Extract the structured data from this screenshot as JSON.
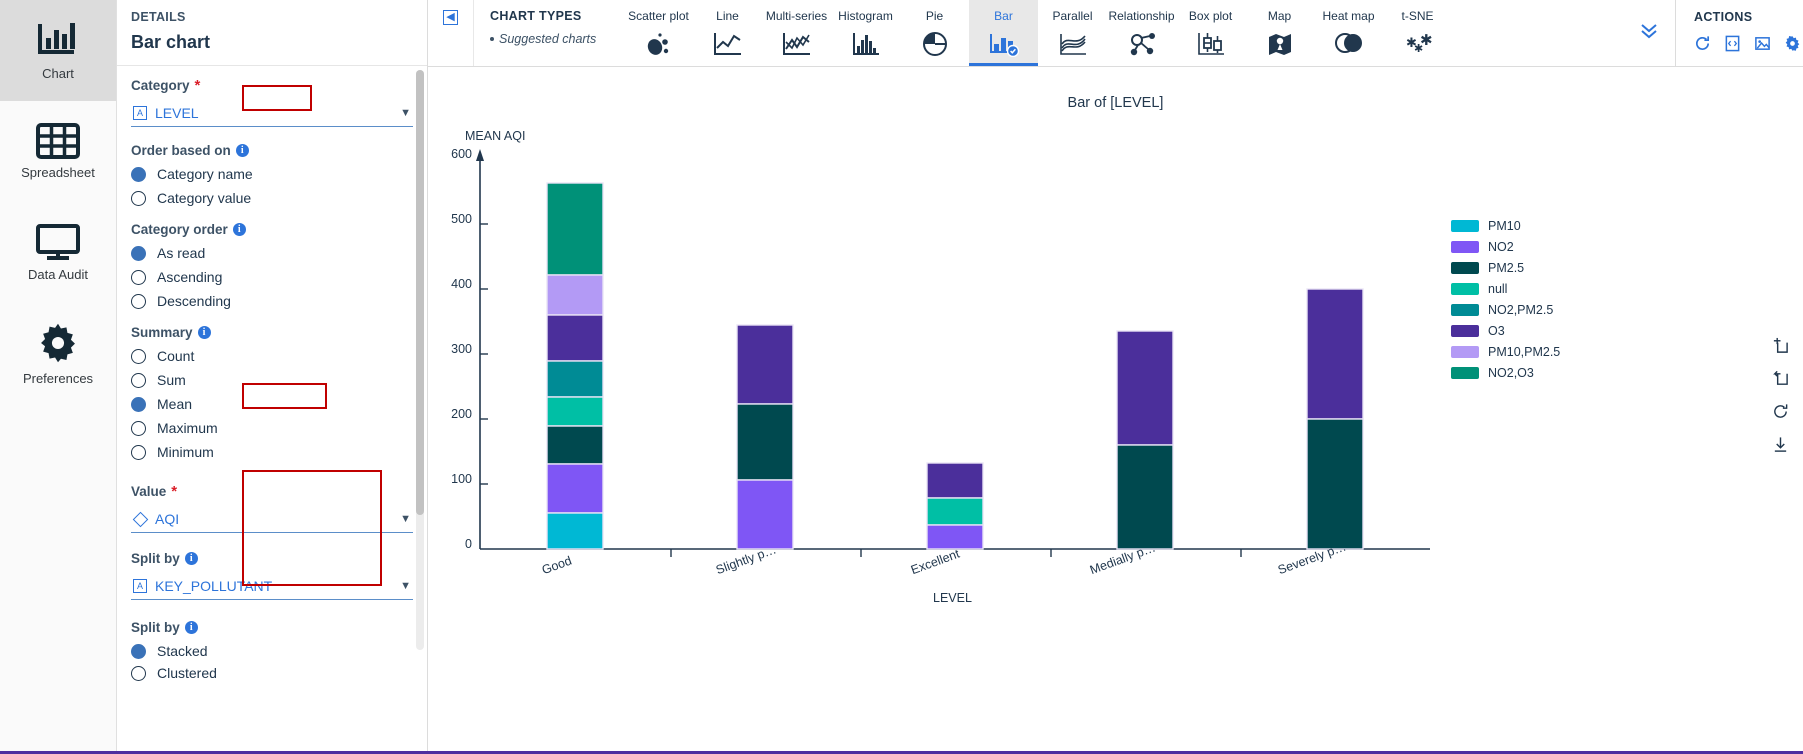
{
  "rail": {
    "items": [
      {
        "label": "Chart",
        "icon": "bar-chart-icon",
        "active": true
      },
      {
        "label": "Spreadsheet",
        "icon": "table-grid-icon",
        "active": false
      },
      {
        "label": "Data Audit",
        "icon": "monitor-icon",
        "active": false
      },
      {
        "label": "Preferences",
        "icon": "gear-icon",
        "active": false
      }
    ]
  },
  "details": {
    "kicker": "DETAILS",
    "title": "Bar chart",
    "category": {
      "label": "Category",
      "required": "*",
      "value": "LEVEL",
      "type_badge": "A"
    },
    "order_based_on": {
      "label": "Order based on",
      "options": [
        "Category name",
        "Category value"
      ],
      "selected": "Category name"
    },
    "category_order": {
      "label": "Category order",
      "options": [
        "As read",
        "Ascending",
        "Descending"
      ],
      "selected": "As read"
    },
    "summary": {
      "label": "Summary",
      "options": [
        "Count",
        "Sum",
        "Mean",
        "Maximum",
        "Minimum"
      ],
      "selected": "Mean"
    },
    "value": {
      "label": "Value",
      "required": "*",
      "value": "AQI",
      "type_badge": "diamond"
    },
    "split_by_field": {
      "label": "Split by",
      "value": "KEY_POLLUTANT",
      "type_badge": "A"
    },
    "split_by_mode": {
      "label": "Split by",
      "options": [
        "Stacked",
        "Clustered"
      ],
      "selected": "Stacked"
    }
  },
  "toolbar": {
    "collapse_icon": "collapse-panel-icon",
    "chart_types_title": "CHART TYPES",
    "suggested_label": "Suggested charts",
    "types": [
      {
        "label": "Scatter plot",
        "icon": "scatter-plot-icon",
        "selected": false
      },
      {
        "label": "Line",
        "icon": "line-chart-icon",
        "selected": false
      },
      {
        "label": "Multi-series",
        "icon": "multi-series-icon",
        "selected": false
      },
      {
        "label": "Histogram",
        "icon": "histogram-icon",
        "selected": false
      },
      {
        "label": "Pie",
        "icon": "pie-chart-icon",
        "selected": false
      },
      {
        "label": "Bar",
        "icon": "bar-chart-icon",
        "selected": true
      },
      {
        "label": "Parallel",
        "icon": "parallel-coords-icon",
        "selected": false
      },
      {
        "label": "Relationship",
        "icon": "relationship-graph-icon",
        "selected": false
      },
      {
        "label": "Box plot",
        "icon": "box-plot-icon",
        "selected": false
      },
      {
        "label": "Map",
        "icon": "map-icon",
        "selected": false
      },
      {
        "label": "Heat map",
        "icon": "heat-map-icon",
        "selected": false
      },
      {
        "label": "t-SNE",
        "icon": "tsne-icon",
        "selected": false
      }
    ],
    "more_icon": "chevron-double-down-icon"
  },
  "actions": {
    "title": "ACTIONS",
    "icons": [
      "refresh-icon",
      "export-code-icon",
      "export-image-icon",
      "gear-icon"
    ]
  },
  "side_tools": [
    "add-frame-icon",
    "undo-frame-icon",
    "reset-icon",
    "download-icon"
  ],
  "chart_data": {
    "type": "bar",
    "title": "Bar of [LEVEL]",
    "xlabel": "LEVEL",
    "ylabel": "MEAN AQI",
    "ylim": [
      0,
      600
    ],
    "yticks": [
      0,
      100,
      200,
      300,
      400,
      500,
      600
    ],
    "grid": false,
    "legend_position": "right",
    "stacked": true,
    "categories": [
      "Good",
      "Slightly p…",
      "Excellent",
      "Medially p…",
      "Severely p…"
    ],
    "series": [
      {
        "name": "PM10",
        "color": "#00b8d4",
        "values": [
          58,
          0,
          0,
          0,
          0
        ]
      },
      {
        "name": "NO2",
        "color": "#7f56f5",
        "values": [
          76,
          106,
          37,
          0,
          0
        ]
      },
      {
        "name": "PM2.5",
        "color": "#00494f",
        "values": [
          58,
          117,
          0,
          160,
          204
        ]
      },
      {
        "name": "null",
        "color": "#00bfa5",
        "values": [
          44,
          0,
          41,
          0,
          0
        ]
      },
      {
        "name": "NO2,PM2.5",
        "color": "#008b95",
        "values": [
          55,
          0,
          0,
          0,
          0
        ]
      },
      {
        "name": "O3",
        "color": "#4b2f9b",
        "values": [
          70,
          121,
          54,
          176,
          200
        ]
      },
      {
        "name": "PM10,PM2.5",
        "color": "#b39af5",
        "values": [
          61,
          0,
          0,
          0,
          0
        ]
      },
      {
        "name": "NO2,O3",
        "color": "#009178",
        "values": [
          142,
          0,
          0,
          0,
          0
        ]
      }
    ],
    "totals": [
      564,
      344,
      132,
      336,
      404
    ]
  }
}
